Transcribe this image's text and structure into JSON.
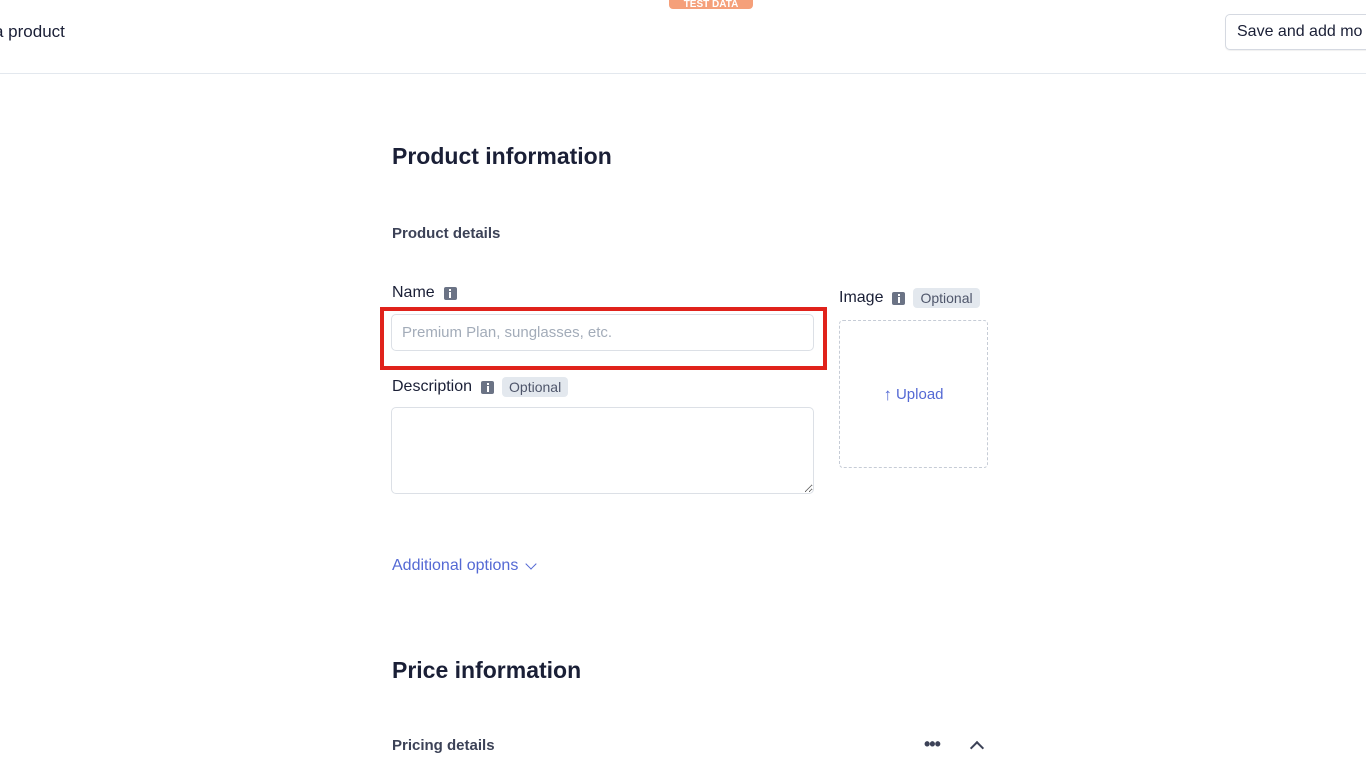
{
  "header": {
    "page_title": "a product",
    "test_badge": "TEST DATA",
    "save_and_add_more_label": "Save and add mo"
  },
  "product_information": {
    "title": "Product information",
    "details_title": "Product details",
    "name": {
      "label": "Name",
      "placeholder": "Premium Plan, sunglasses, etc.",
      "value": ""
    },
    "description": {
      "label": "Description",
      "optional_tag": "Optional",
      "value": ""
    },
    "image": {
      "label": "Image",
      "optional_tag": "Optional",
      "upload_label": "Upload",
      "upload_icon": "arrow-up-icon"
    },
    "additional_options_label": "Additional options"
  },
  "price_information": {
    "title": "Price information",
    "pricing_details_title": "Pricing details",
    "more_icon": "ellipsis-icon",
    "collapse_icon": "chevron-up-icon"
  },
  "colors": {
    "accent": "#5469d4",
    "highlight": "#e0221b",
    "test_badge": "#f5a07a"
  }
}
